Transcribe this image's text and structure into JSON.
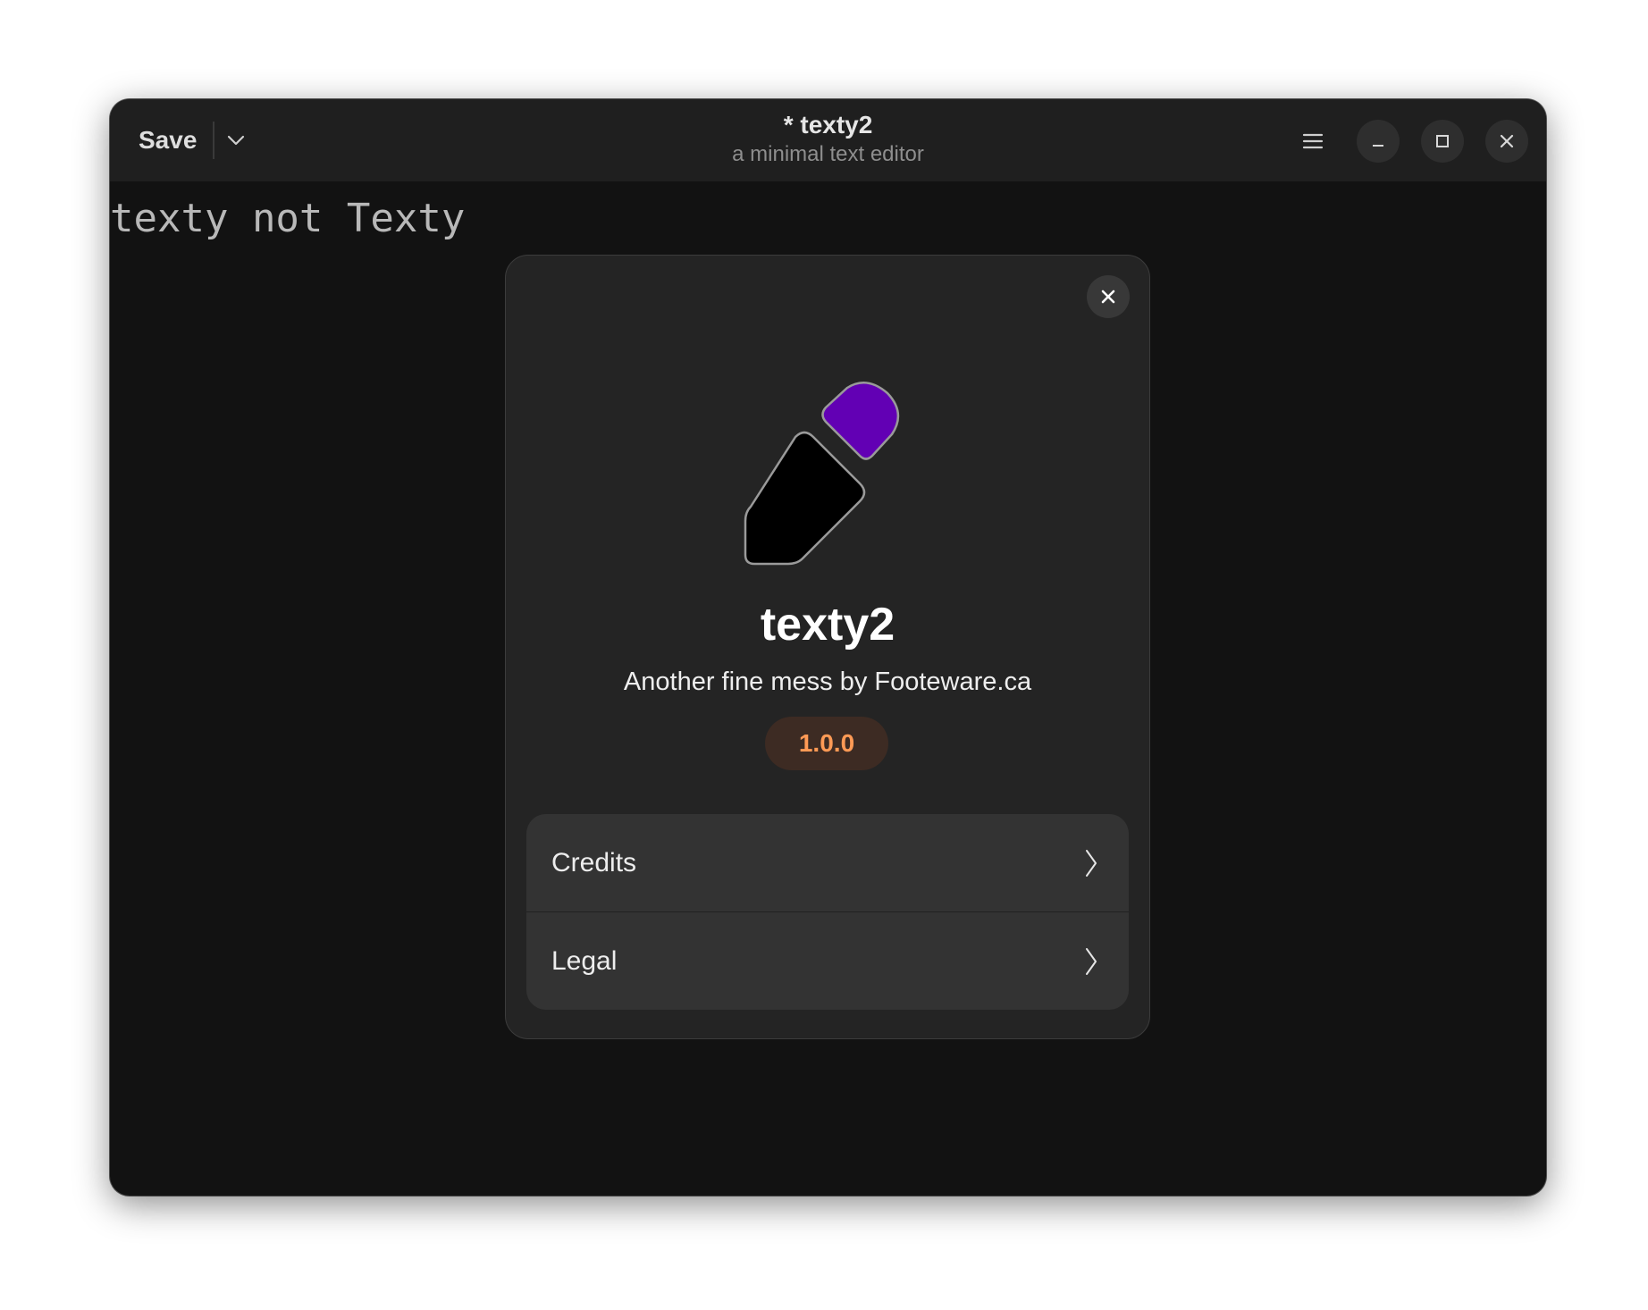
{
  "header": {
    "save_label": "Save",
    "title": "* texty2",
    "subtitle": "a minimal text editor"
  },
  "editor": {
    "content": "texty not Texty"
  },
  "about_dialog": {
    "app_name": "texty2",
    "tagline": "Another fine mess by Footeware.ca",
    "version": "1.0.0",
    "rows": [
      {
        "label": "Credits"
      },
      {
        "label": "Legal"
      }
    ],
    "logo_colors": {
      "body": "#000000",
      "cap": "#6200b4",
      "outline": "#9a9a9a"
    },
    "accent_color": "#ff9a55"
  },
  "icons": {
    "save_dropdown": "chevron-down-icon",
    "menu": "hamburger-menu-icon",
    "minimize": "minimize-icon",
    "maximize": "maximize-icon",
    "close": "close-icon",
    "dialog_close": "close-icon",
    "row_arrow": "chevron-right-icon"
  }
}
